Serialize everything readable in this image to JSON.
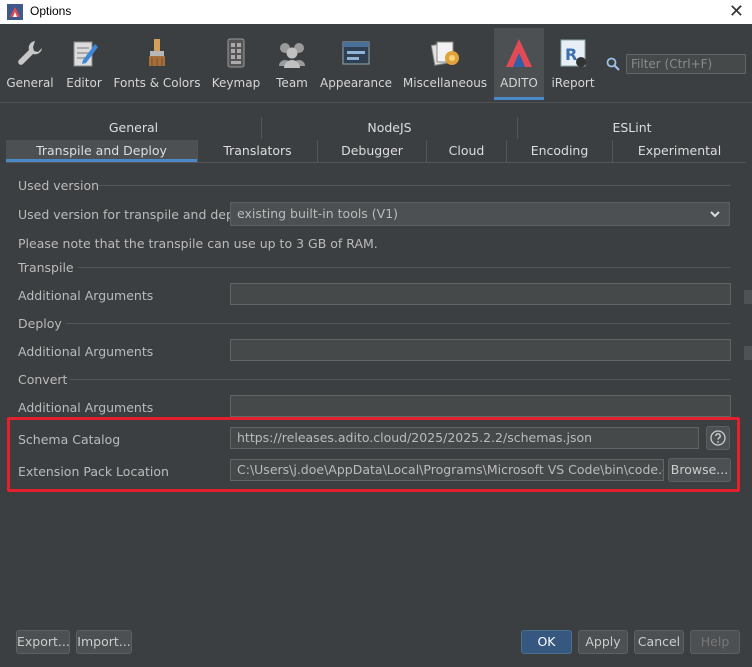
{
  "window": {
    "title": "Options",
    "close_glyph": "✕"
  },
  "toolbar": {
    "items": [
      {
        "label": "General",
        "icon": "wrench-icon"
      },
      {
        "label": "Editor",
        "icon": "editor-icon"
      },
      {
        "label": "Fonts & Colors",
        "icon": "brush-icon"
      },
      {
        "label": "Keymap",
        "icon": "keyboard-icon"
      },
      {
        "label": "Team",
        "icon": "team-icon"
      },
      {
        "label": "Appearance",
        "icon": "window-icon"
      },
      {
        "label": "Miscellaneous",
        "icon": "misc-icon"
      },
      {
        "label": "ADITO",
        "icon": "adito-logo-icon",
        "selected": true
      },
      {
        "label": "iReport",
        "icon": "ireport-icon"
      }
    ],
    "filter_placeholder": "Filter (Ctrl+F)"
  },
  "tabs": {
    "top": [
      "General",
      "NodeJS",
      "ESLint"
    ],
    "bottom": [
      "Transpile and Deploy",
      "Translators",
      "Debugger",
      "Cloud",
      "Encoding",
      "Experimental"
    ],
    "selected": "Transpile and Deploy"
  },
  "form": {
    "used_version_section": "Used version",
    "used_version_label": "Used version for transpile and deploy",
    "used_version_value": "existing built-in tools (V1)",
    "ram_note": "Please note that the transpile can use up to 3 GB of RAM.",
    "transpile_section": "Transpile",
    "transpile_args_label": "Additional Arguments",
    "transpile_args_value": "",
    "deploy_section": "Deploy",
    "deploy_args_label": "Additional Arguments",
    "deploy_args_value": "",
    "convert_section": "Convert",
    "convert_args_label": "Additional Arguments",
    "convert_args_value": "",
    "schema_catalog_label": "Schema Catalog",
    "schema_catalog_value": "https://releases.adito.cloud/2025/2025.2.2/schemas.json",
    "extension_pack_label": "Extension Pack Location",
    "extension_pack_value": "C:\\Users\\j.doe\\AppData\\Local\\Programs\\Microsoft VS Code\\bin\\code.cmd",
    "browse_label": "Browse..."
  },
  "footer": {
    "export_label": "Export...",
    "import_label": "Import...",
    "ok_label": "OK",
    "apply_label": "Apply",
    "cancel_label": "Cancel",
    "help_label": "Help"
  },
  "colors": {
    "accent": "#4a88c7",
    "highlight": "#e3202c",
    "primary_button": "#365880"
  }
}
